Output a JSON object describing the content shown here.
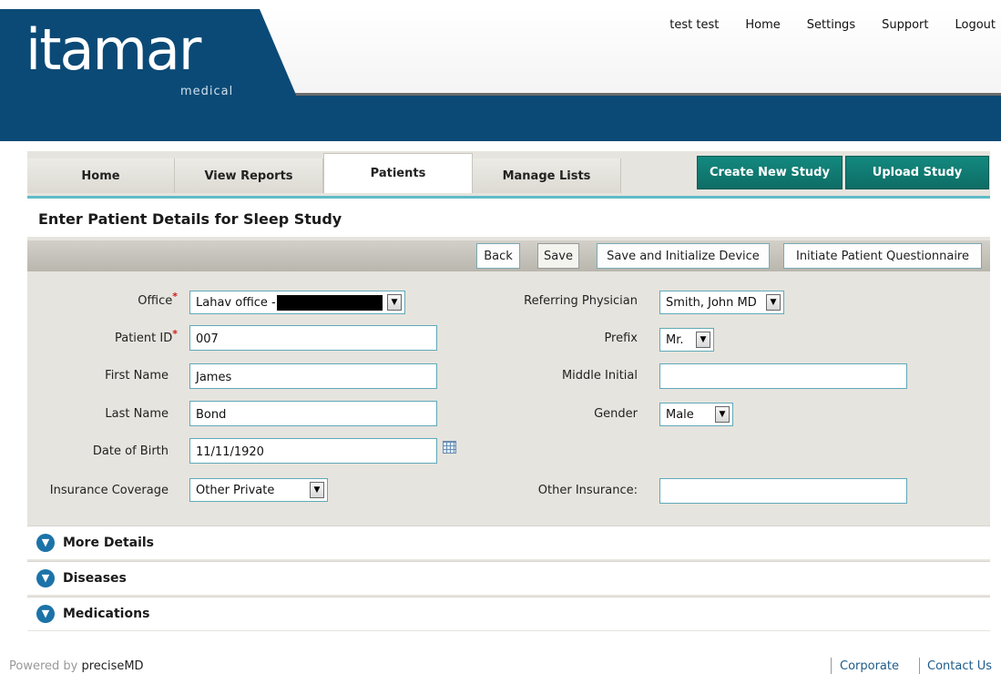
{
  "header": {
    "logo_main": "itamar",
    "logo_sub": "medical",
    "nav": {
      "user": "test test",
      "home": "Home",
      "settings": "Settings",
      "support": "Support",
      "logout": "Logout"
    }
  },
  "tabs": [
    "Home",
    "View Reports",
    "Patients",
    "Manage Lists"
  ],
  "active_tab": "Patients",
  "actions": {
    "create": "Create New Study",
    "upload": "Upload Study"
  },
  "page_title": "Enter Patient Details for Sleep Study",
  "toolbar": {
    "back": "Back",
    "save": "Save",
    "save_init": "Save and Initialize Device",
    "questionnaire": "Initiate Patient Questionnaire"
  },
  "form": {
    "office_label": "Office",
    "office_value": "Lahav office -",
    "patient_id_label": "Patient ID",
    "patient_id_value": "007",
    "first_name_label": "First Name",
    "first_name_value": "James",
    "last_name_label": "Last Name",
    "last_name_value": "Bond",
    "dob_label": "Date of Birth",
    "dob_value": "11/11/1920",
    "insurance_label": "Insurance Coverage",
    "insurance_value": "Other Private",
    "ref_phys_label": "Referring Physician",
    "ref_phys_value": "Smith, John MD",
    "prefix_label": "Prefix",
    "prefix_value": "Mr.",
    "middle_label": "Middle Initial",
    "middle_value": "",
    "gender_label": "Gender",
    "gender_value": "Male",
    "other_ins_label": "Other Insurance:",
    "other_ins_value": "",
    "required_mark": "*"
  },
  "sections": [
    "More Details",
    "Diseases",
    "Medications"
  ],
  "footer": {
    "powered_prefix": "Powered by",
    "powered_brand": "preciseMD",
    "corporate": "Corporate",
    "contact": "Contact Us"
  },
  "colors": {
    "brand_blue": "#0b4a76",
    "action_teal": "#13897f",
    "accent_cyan": "#5fbcc7",
    "required_red": "#d21d1d"
  }
}
